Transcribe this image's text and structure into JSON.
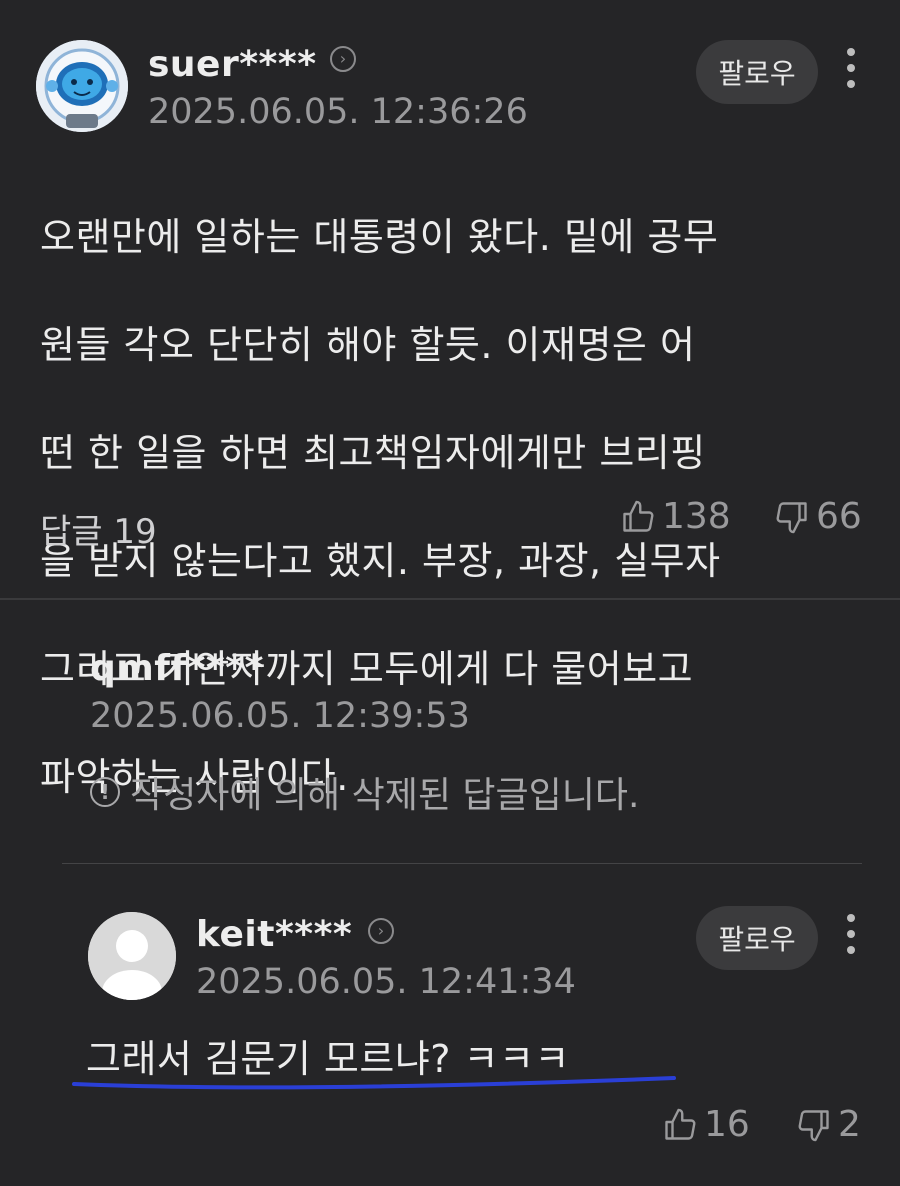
{
  "comment1": {
    "username": "suer****",
    "date": "2025.06.05. 12:36:26",
    "follow_label": "팔로우",
    "body_lines": [
      "오랜만에 일하는 대통령이 왔다. 밑에 공무",
      "원들 각오 단단히 해야 할듯. 이재명은 어",
      "떤 한 일을 하면 최고책임자에게만 브리핑",
      "을 받지 않는다고 했지. 부장, 과장, 실무자",
      "그리고 기안자까지 모두에게 다 물어보고",
      "파악하는 사람이다."
    ],
    "reply_label": "답글 19",
    "likes": "138",
    "dislikes": "66",
    "avatar_icon": "astronaut-avatar-icon"
  },
  "reply1": {
    "username": "qmff****",
    "date": "2025.06.05. 12:39:53",
    "deleted_notice": "작성자에 의해 삭제된 답글입니다.",
    "notice_icon": "info-icon"
  },
  "reply2": {
    "username": "keit****",
    "date": "2025.06.05. 12:41:34",
    "follow_label": "팔로우",
    "body": "그래서 김문기 모르냐? ㅋㅋㅋ",
    "likes": "16",
    "dislikes": "2",
    "avatar_icon": "default-user-avatar-icon",
    "underline_color": "#2a3fd6"
  },
  "colors": {
    "background": "#252527",
    "follow_button": "#3b3b3d",
    "text": "#ececec",
    "muted": "#9a9a9c"
  }
}
